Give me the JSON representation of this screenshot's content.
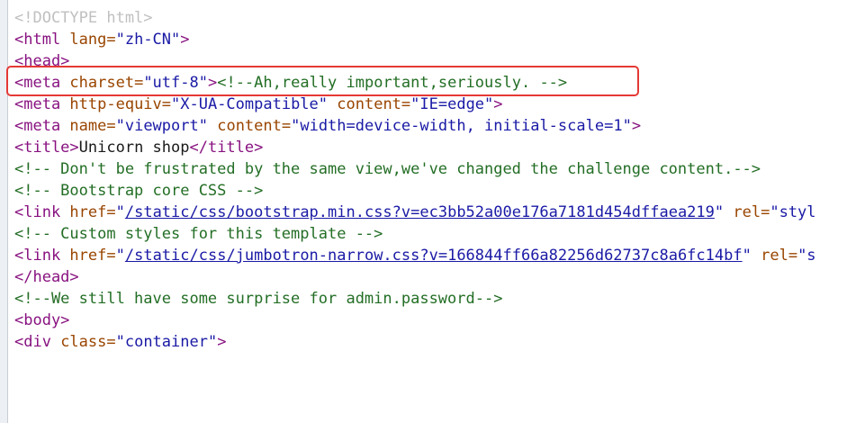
{
  "source": {
    "lines": [
      [
        {
          "c": "doctype",
          "t": "<!DOCTYPE html>"
        }
      ],
      [
        {
          "c": "tag",
          "t": "<html "
        },
        {
          "c": "attr",
          "t": "lang="
        },
        {
          "c": "val",
          "t": "\"zh-CN\""
        },
        {
          "c": "tag",
          "t": ">"
        }
      ],
      [
        {
          "c": "tag",
          "t": "<head>"
        }
      ],
      [
        {
          "c": "tag",
          "t": "<meta "
        },
        {
          "c": "attr",
          "t": "charset="
        },
        {
          "c": "val",
          "t": "\"utf-8\""
        },
        {
          "c": "tag",
          "t": ">"
        },
        {
          "c": "comment",
          "t": "<!--Ah,really important,seriously. -->"
        }
      ],
      [
        {
          "c": "tag",
          "t": "<meta "
        },
        {
          "c": "attr",
          "t": "http-equiv="
        },
        {
          "c": "val",
          "t": "\"X-UA-Compatible\""
        },
        {
          "c": "text",
          "t": " "
        },
        {
          "c": "attr",
          "t": "content="
        },
        {
          "c": "val",
          "t": "\"IE=edge\""
        },
        {
          "c": "tag",
          "t": ">"
        }
      ],
      [
        {
          "c": "tag",
          "t": "<meta "
        },
        {
          "c": "attr",
          "t": "name="
        },
        {
          "c": "val",
          "t": "\"viewport\""
        },
        {
          "c": "text",
          "t": " "
        },
        {
          "c": "attr",
          "t": "content="
        },
        {
          "c": "val",
          "t": "\"width=device-width, initial-scale=1\""
        },
        {
          "c": "tag",
          "t": ">"
        }
      ],
      [
        {
          "c": "tag",
          "t": "<title>"
        },
        {
          "c": "text",
          "t": "Unicorn shop"
        },
        {
          "c": "tag",
          "t": "</title>"
        }
      ],
      [
        {
          "c": "comment",
          "t": "<!-- Don't be frustrated by the same view,we've changed the challenge content.-->"
        }
      ],
      [
        {
          "c": "comment",
          "t": "<!-- Bootstrap core CSS -->"
        }
      ],
      [
        {
          "c": "tag",
          "t": "<link "
        },
        {
          "c": "attr",
          "t": "href="
        },
        {
          "c": "val",
          "t": "\""
        },
        {
          "c": "link",
          "t": "/static/css/bootstrap.min.css?v=ec3bb52a00e176a7181d454dffaea219"
        },
        {
          "c": "val",
          "t": "\""
        },
        {
          "c": "text",
          "t": " "
        },
        {
          "c": "attr",
          "t": "rel="
        },
        {
          "c": "val",
          "t": "\"styl"
        }
      ],
      [
        {
          "c": "comment",
          "t": "<!-- Custom styles for this template -->"
        }
      ],
      [
        {
          "c": "tag",
          "t": "<link "
        },
        {
          "c": "attr",
          "t": "href="
        },
        {
          "c": "val",
          "t": "\""
        },
        {
          "c": "link",
          "t": "/static/css/jumbotron-narrow.css?v=166844ff66a82256d62737c8a6fc14bf"
        },
        {
          "c": "val",
          "t": "\""
        },
        {
          "c": "text",
          "t": " "
        },
        {
          "c": "attr",
          "t": "rel="
        },
        {
          "c": "val",
          "t": "\"s"
        }
      ],
      [
        {
          "c": "tag",
          "t": "</head>"
        }
      ],
      [
        {
          "c": "comment",
          "t": "<!--We still have some surprise for admin.password-->"
        }
      ],
      [
        {
          "c": "tag",
          "t": "<body>"
        }
      ],
      [
        {
          "c": "tag",
          "t": "<div "
        },
        {
          "c": "attr",
          "t": "class="
        },
        {
          "c": "val",
          "t": "\"container\""
        },
        {
          "c": "tag",
          "t": ">"
        }
      ]
    ]
  },
  "colors": {
    "highlight_border": "#e53935",
    "tag": "#881280",
    "attribute": "#994500",
    "value": "#1a1aa6",
    "comment": "#236e25"
  }
}
